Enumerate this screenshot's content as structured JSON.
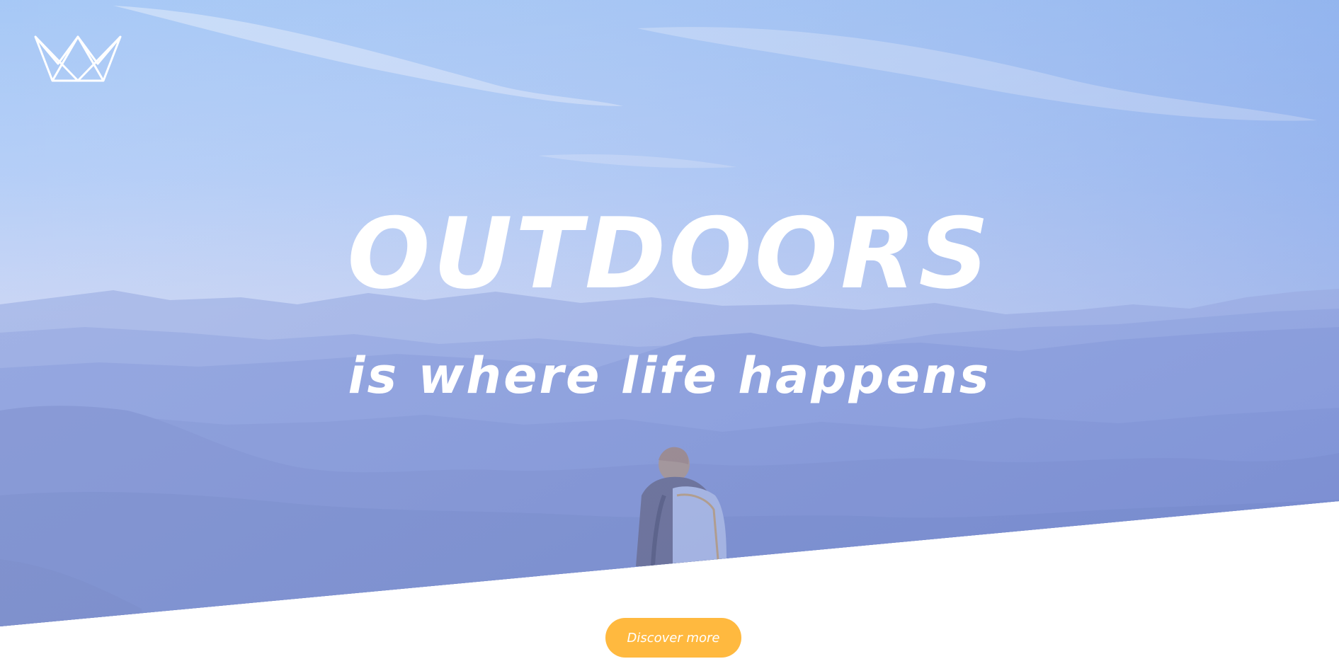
{
  "logo": {
    "icon": "crown-icon",
    "color": "#ffffff"
  },
  "hero": {
    "headline": "OUTDOORS",
    "tagline": "is where life happens",
    "image": "hiker-mountain-landscape"
  },
  "cta": {
    "label": "Discover more",
    "color": "#ffb93f",
    "text_color": "#ffffff"
  },
  "colors": {
    "sky_top": "#a9cdf8",
    "overlay": "#7f8fe0",
    "page_background": "#ffffff"
  }
}
